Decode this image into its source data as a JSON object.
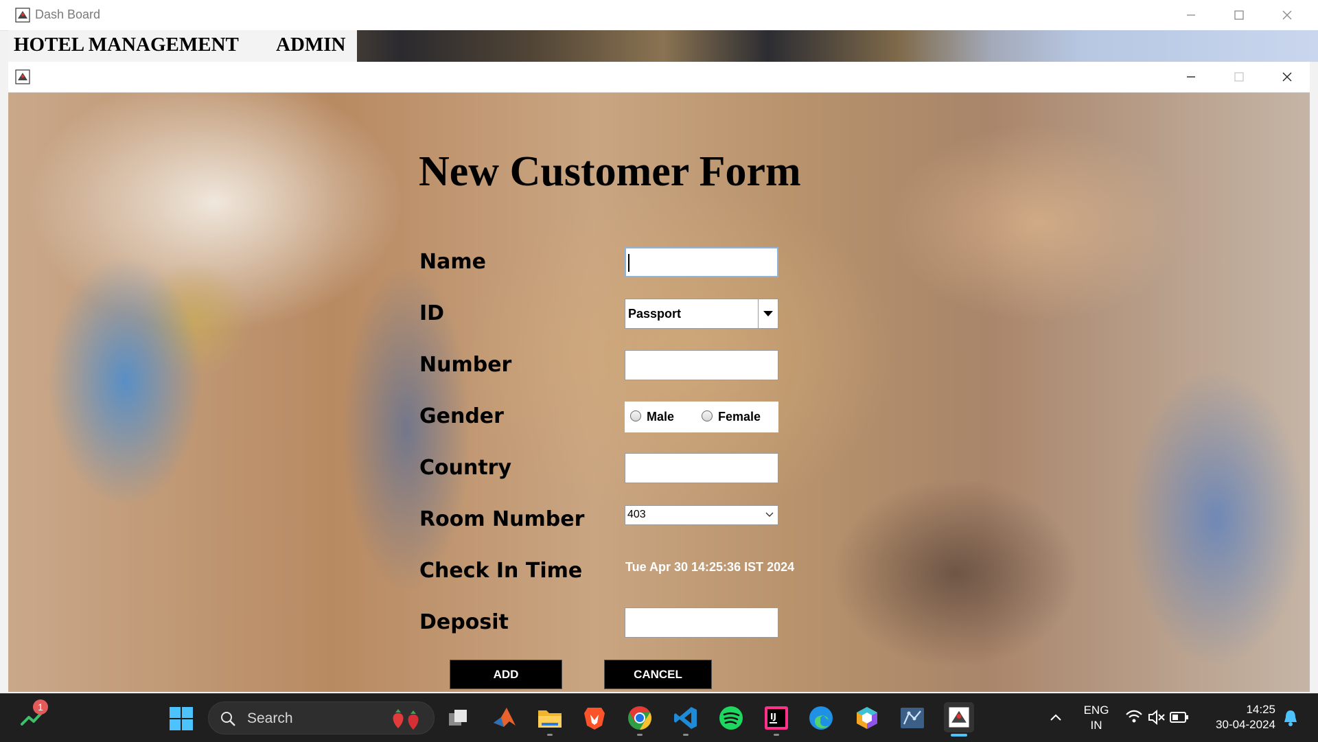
{
  "outer_window": {
    "title": "Dash Board"
  },
  "menubar": {
    "items": [
      "HOTEL MANAGEMENT",
      "ADMIN"
    ]
  },
  "form": {
    "title": "New Customer Form",
    "labels": {
      "name": "Name",
      "id": "ID",
      "number": "Number",
      "gender": "Gender",
      "country": "Country",
      "room_number": "Room Number",
      "check_in_time": "Check In Time",
      "deposit": "Deposit"
    },
    "values": {
      "name": "",
      "id_type": "Passport",
      "number": "",
      "country": "",
      "room_number": "403",
      "check_in_time": "Tue Apr 30 14:25:36 IST 2024",
      "deposit": ""
    },
    "gender_options": {
      "male": "Male",
      "female": "Female"
    },
    "buttons": {
      "add": "ADD",
      "cancel": "CANCEL"
    }
  },
  "taskbar": {
    "search_label": "Search",
    "notification_badge": "1",
    "language_line1": "ENG",
    "language_line2": "IN",
    "time": "14:25",
    "date": "30-04-2024",
    "accent_color": "#4cc2ff"
  }
}
